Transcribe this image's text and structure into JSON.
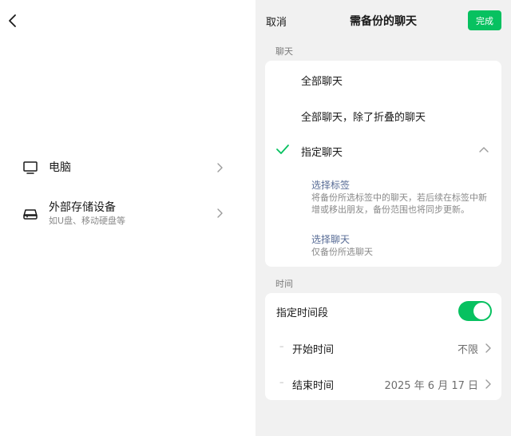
{
  "left": {
    "items": [
      {
        "title": "电脑",
        "icon": "monitor-icon"
      },
      {
        "title": "外部存储设备",
        "subtitle": "如U盘、移动硬盘等",
        "icon": "drive-icon"
      }
    ]
  },
  "header": {
    "cancel": "取消",
    "title": "需备份的聊天",
    "done": "完成"
  },
  "chats_section": {
    "label": "聊天",
    "options": [
      {
        "label": "全部聊天",
        "selected": false
      },
      {
        "label": "全部聊天，除了折叠的聊天",
        "selected": false
      },
      {
        "label": "指定聊天",
        "selected": true
      }
    ],
    "sub_options": [
      {
        "title": "选择标签",
        "desc": "将备份所选标签中的聊天，若后续在标签中新增或移出朋友，备份范围也将同步更新。"
      },
      {
        "title": "选择聊天",
        "desc": "仅备份所选聊天"
      }
    ]
  },
  "time_section": {
    "label": "时间",
    "toggle_label": "指定时间段",
    "toggle_on": true,
    "rows": [
      {
        "label": "开始时间",
        "value": "不限"
      },
      {
        "label": "结束时间",
        "value": "2025 年 6 月 17 日"
      }
    ]
  },
  "colors": {
    "accent": "#07c160",
    "link": "#576b95",
    "panel_bg": "#f1f1f1"
  }
}
